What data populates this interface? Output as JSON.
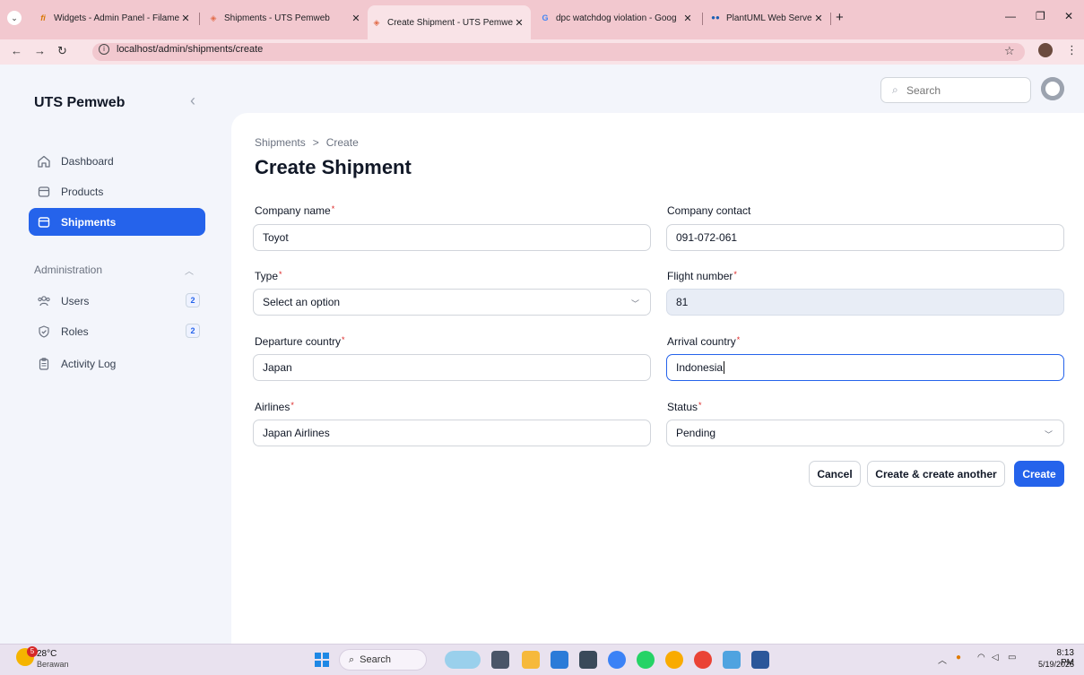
{
  "browser": {
    "tabs": [
      {
        "title": "Widgets - Admin Panel - Filame"
      },
      {
        "title": "Shipments - UTS Pemweb"
      },
      {
        "title": "Create Shipment - UTS Pemwel"
      },
      {
        "title": "dpc watchdog violation - Goog"
      },
      {
        "title": "PlantUML Web Server"
      }
    ],
    "url": "localhost/admin/shipments/create"
  },
  "app": {
    "brand": "UTS Pemweb",
    "search_placeholder": "Search",
    "nav": [
      {
        "label": "Dashboard",
        "icon": "home-icon"
      },
      {
        "label": "Products",
        "icon": "box-icon"
      },
      {
        "label": "Shipments",
        "icon": "box-icon"
      }
    ],
    "admin_group": {
      "label": "Administration",
      "items": [
        {
          "label": "Users",
          "icon": "users-icon",
          "badge": "2"
        },
        {
          "label": "Roles",
          "icon": "shield-icon",
          "badge": "2"
        },
        {
          "label": "Activity Log",
          "icon": "clipboard-icon"
        }
      ]
    }
  },
  "page": {
    "breadcrumb": [
      "Shipments",
      "Create"
    ],
    "breadcrumb_sep": ">",
    "title": "Create Shipment"
  },
  "form": {
    "company_name": {
      "label": "Company name",
      "value": "Toyot"
    },
    "company_contact": {
      "label": "Company contact",
      "value": "091-072-061"
    },
    "type": {
      "label": "Type",
      "value": "Select an option"
    },
    "flight_number": {
      "label": "Flight number",
      "value": "81"
    },
    "departure_country": {
      "label": "Departure country",
      "value": "Japan"
    },
    "arrival_country": {
      "label": "Arrival country",
      "value": "Indonesia"
    },
    "airlines": {
      "label": "Airlines",
      "value": "Japan Airlines"
    },
    "status": {
      "label": "Status",
      "value": "Pending"
    },
    "required_mark": "*",
    "buttons": {
      "cancel": "Cancel",
      "create_another": "Create & create another",
      "create": "Create"
    }
  },
  "taskbar": {
    "weather_badge": "5",
    "temp": "28°C",
    "weather": "Berawan",
    "search": "Search",
    "time": "8:13 PM",
    "date": "5/19/2025"
  },
  "colors": {
    "primary": "#2563eb",
    "required": "#dc2626"
  }
}
